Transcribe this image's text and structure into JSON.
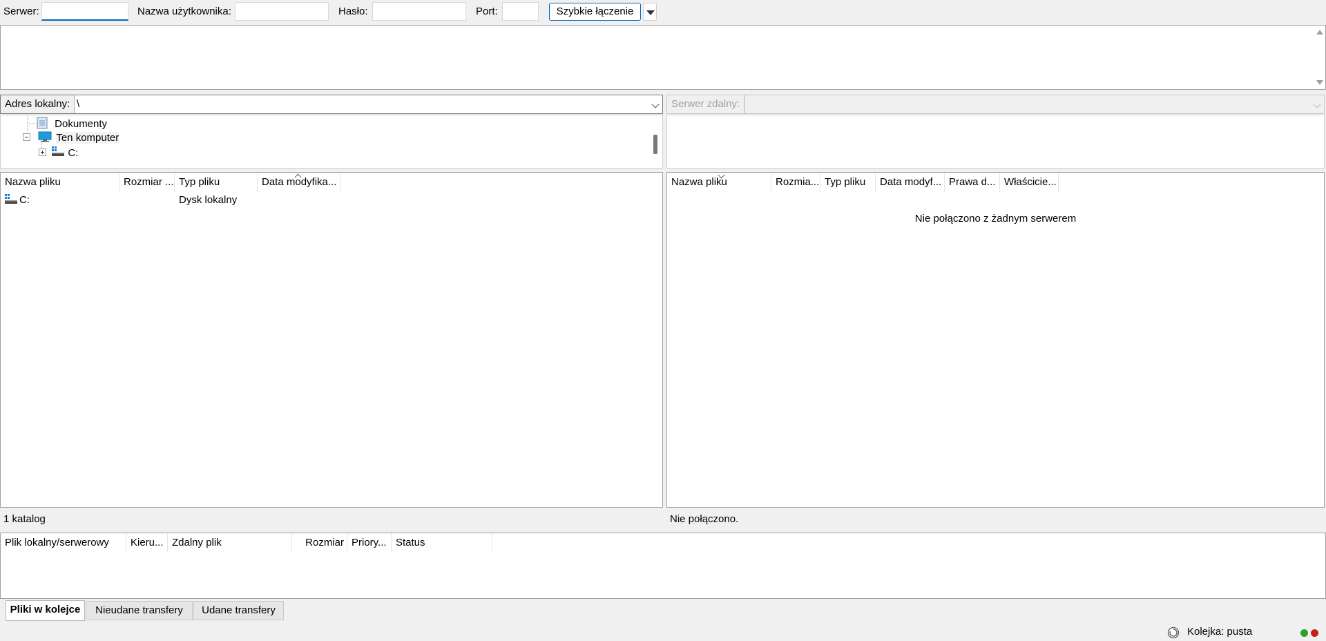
{
  "quickconnect": {
    "server_label": "Serwer:",
    "user_label": "Nazwa użytkownika:",
    "password_label": "Hasło:",
    "port_label": "Port:",
    "server_value": "",
    "user_value": "",
    "password_value": "",
    "port_value": "",
    "connect_button": "Szybkie łączenie"
  },
  "local": {
    "address_label": "Adres lokalny:",
    "address_value": "\\",
    "tree": [
      {
        "label": "Dokumenty",
        "icon": "documents-icon"
      },
      {
        "label": "Ten komputer",
        "icon": "computer-icon",
        "expanded": true
      },
      {
        "label": "C:",
        "icon": "drive-icon",
        "expandable": true
      }
    ],
    "columns": [
      "Nazwa pliku",
      "Rozmiar ...",
      "Typ pliku",
      "Data modyfika..."
    ],
    "rows": [
      {
        "name": "C:",
        "size": "",
        "type": "Dysk lokalny",
        "date": ""
      }
    ],
    "status": "1 katalog"
  },
  "remote": {
    "address_label": "Serwer zdalny:",
    "address_value": "",
    "columns": [
      "Nazwa pliku",
      "Rozmia...",
      "Typ pliku",
      "Data modyf...",
      "Prawa d...",
      "Właścicie..."
    ],
    "empty_message": "Nie połączono z żadnym serwerem",
    "status": "Nie połączono."
  },
  "queue": {
    "columns": [
      "Plik lokalny/serwerowy",
      "Kieru...",
      "Zdalny plik",
      "Rozmiar",
      "Priory...",
      "Status"
    ]
  },
  "tabs": [
    {
      "label": "Pliki w kolejce",
      "active": true
    },
    {
      "label": "Nieudane transfery",
      "active": false
    },
    {
      "label": "Udane transfery",
      "active": false
    }
  ],
  "statusbar": {
    "queue_text": "Kolejka: pusta"
  },
  "colors": {
    "accent": "#0067c0",
    "led_green": "#2e9e2e",
    "led_red": "#c21f1f"
  }
}
